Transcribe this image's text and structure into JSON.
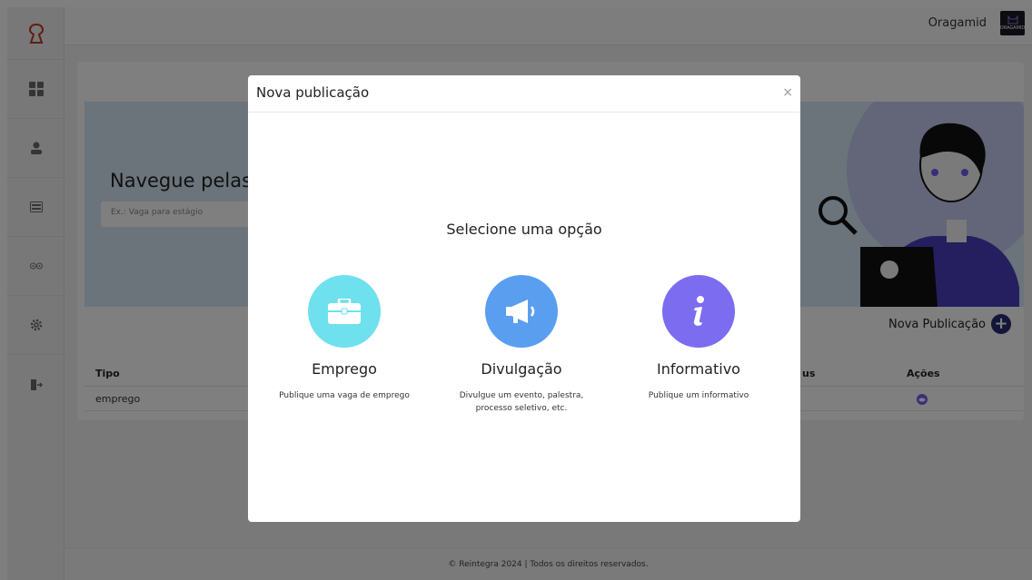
{
  "header": {
    "user_name": "Oragamid",
    "avatar_text": "ORAGAMID"
  },
  "sidebar": {
    "logo_icon": "keyhole-logo-icon",
    "items": [
      {
        "icon": "dashboard-grid-icon"
      },
      {
        "icon": "user-icon"
      },
      {
        "icon": "id-card-icon"
      },
      {
        "icon": "people-icon"
      },
      {
        "icon": "gear-icon"
      },
      {
        "icon": "logout-icon"
      }
    ]
  },
  "hero": {
    "title": "Navegue pelas pu",
    "search_placeholder": "Ex.: Vaga para estágio"
  },
  "actions": {
    "new_publication_label": "Nova Publicação"
  },
  "table": {
    "headers": {
      "tipo": "Tipo",
      "status": "us",
      "acoes": "Ações"
    },
    "rows": [
      {
        "tipo": "emprego",
        "status": ""
      }
    ]
  },
  "footer": {
    "text": "© Reintegra 2024 | Todos os direitos reservados."
  },
  "modal": {
    "title": "Nova publicação",
    "close_symbol": "×",
    "subtitle": "Selecione uma opção",
    "options": [
      {
        "title": "Emprego",
        "description": "Publique uma vaga de emprego",
        "icon": "briefcase-icon",
        "color": "#6fe0ee"
      },
      {
        "title": "Divulgação",
        "description": "Divulgue um evento, palestra, processo seletivo, etc.",
        "icon": "megaphone-icon",
        "color": "#5a9ef0"
      },
      {
        "title": "Informativo",
        "description": "Publique um informativo",
        "icon": "info-icon",
        "color": "#7b6cf0"
      }
    ]
  },
  "colors": {
    "accent_dark": "#262a73",
    "hero_bg": "#d6e7f6",
    "logo": "#c0392b"
  }
}
